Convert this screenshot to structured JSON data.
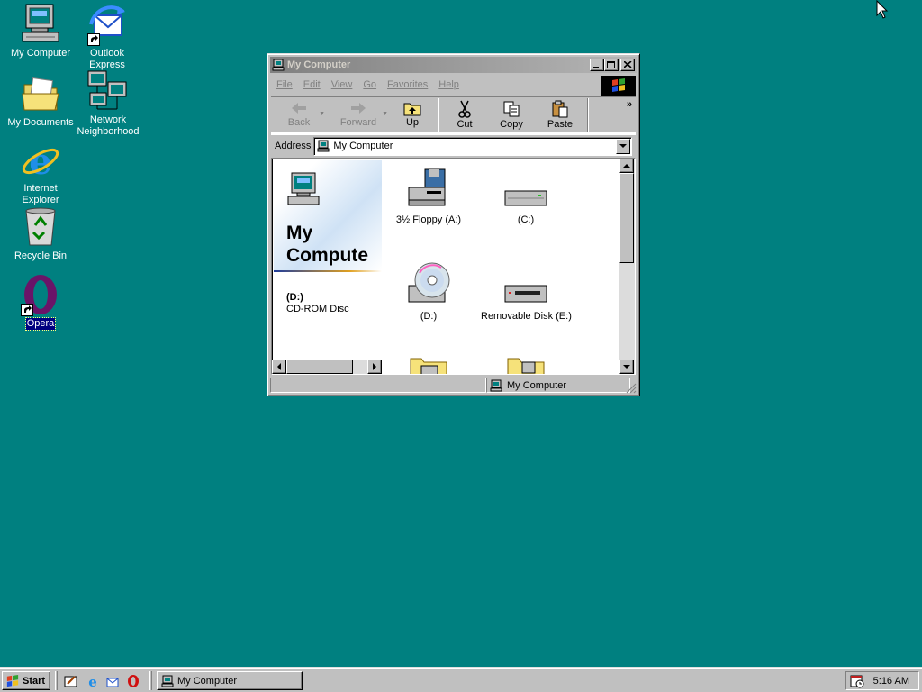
{
  "desktop": {
    "background_color": "#008080",
    "icons": [
      {
        "label": "My Computer",
        "icon": "my-computer-icon"
      },
      {
        "label": "Outlook Express",
        "icon": "outlook-express-icon"
      },
      {
        "label": "My Documents",
        "icon": "my-documents-icon"
      },
      {
        "label": "Network Neighborhood",
        "icon": "network-neighborhood-icon"
      },
      {
        "label": "Internet Explorer",
        "icon": "internet-explorer-icon"
      },
      {
        "label": "Recycle Bin",
        "icon": "recycle-bin-icon"
      },
      {
        "label": "Opera",
        "icon": "opera-icon",
        "selected": true
      }
    ]
  },
  "window": {
    "title": "My Computer",
    "active": false,
    "menu": [
      "File",
      "Edit",
      "View",
      "Go",
      "Favorites",
      "Help"
    ],
    "toolbar": {
      "back": "Back",
      "forward": "Forward",
      "up": "Up",
      "cut": "Cut",
      "copy": "Copy",
      "paste": "Paste"
    },
    "address": {
      "label": "Address",
      "value": "My Computer"
    },
    "webview": {
      "heading_line1": "My",
      "heading_line2": "Compute",
      "selected_name": "(D:)",
      "selected_type": "CD-ROM Disc"
    },
    "items": [
      {
        "label": "3½ Floppy (A:)",
        "icon": "floppy-drive-icon"
      },
      {
        "label": "(C:)",
        "icon": "hard-disk-icon"
      },
      {
        "label": "(D:)",
        "icon": "cdrom-drive-icon"
      },
      {
        "label": "Removable Disk (E:)",
        "icon": "removable-disk-icon"
      },
      {
        "label": "",
        "icon": "printers-folder-icon"
      },
      {
        "label": "",
        "icon": "control-panel-folder-icon"
      }
    ],
    "status": {
      "location": "My Computer"
    }
  },
  "taskbar": {
    "start_label": "Start",
    "quick_launch": [
      "show-desktop-icon",
      "internet-explorer-icon",
      "outlook-express-icon",
      "opera-icon"
    ],
    "tasks": [
      {
        "label": "My Computer"
      }
    ],
    "clock": "5:16 AM"
  }
}
